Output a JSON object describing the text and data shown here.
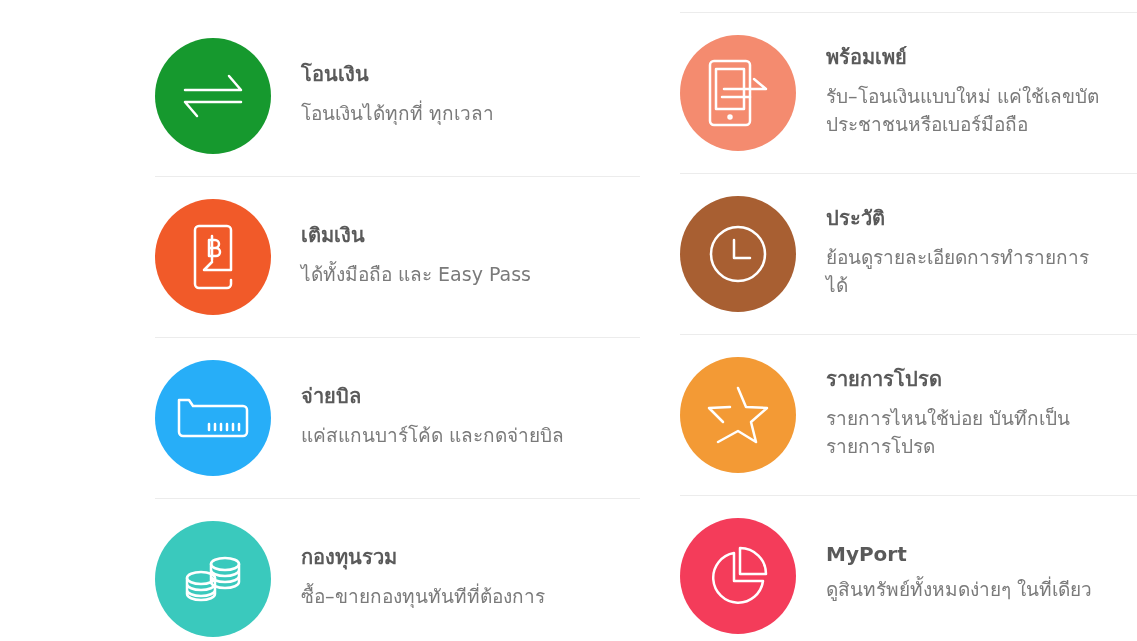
{
  "columns": [
    {
      "items": [
        {
          "title": "โอนเงิน",
          "color": "#16992e",
          "description": [
            "โอนเงินได้ทุกที่ ทุกเวลา"
          ]
        },
        {
          "title": "เติมเงิน",
          "color": "#f15a29",
          "description": [
            "ได้ทั้งมือถือ และ Easy Pass"
          ]
        },
        {
          "title": "จ่ายบิล",
          "color": "#27aef8",
          "description": [
            "แค่สแกนบาร์โค้ด และกดจ่ายบิล"
          ]
        },
        {
          "title": "กองทุนรวม",
          "color": "#3ac9bd",
          "description": [
            "ซื้อ–ขายกองทุนทันทีที่ต้องการ"
          ]
        }
      ]
    },
    {
      "items": [
        {
          "title": "พร้อมเพย์",
          "color": "#f48b6f",
          "description": [
            "รับ–โอนเงินแบบใหม่ แค่ใช้เลขบัต",
            "ประชาชนหรือเบอร์มือถือ"
          ]
        },
        {
          "title": "ประวัติ",
          "color": "#a85f32",
          "description": [
            "ย้อนดูรายละเอียดการทำรายการ",
            "ได้"
          ]
        },
        {
          "title": "รายการโปรด",
          "color": "#f39a35",
          "description": [
            "รายการไหนใช้บ่อย บันทึกเป็น",
            "รายการโปรด"
          ]
        },
        {
          "title": "MyPort",
          "color": "#f43c5a",
          "description": [
            "ดูสินทรัพย์ทั้งหมดง่ายๆ ในที่เดียว"
          ]
        }
      ]
    }
  ]
}
